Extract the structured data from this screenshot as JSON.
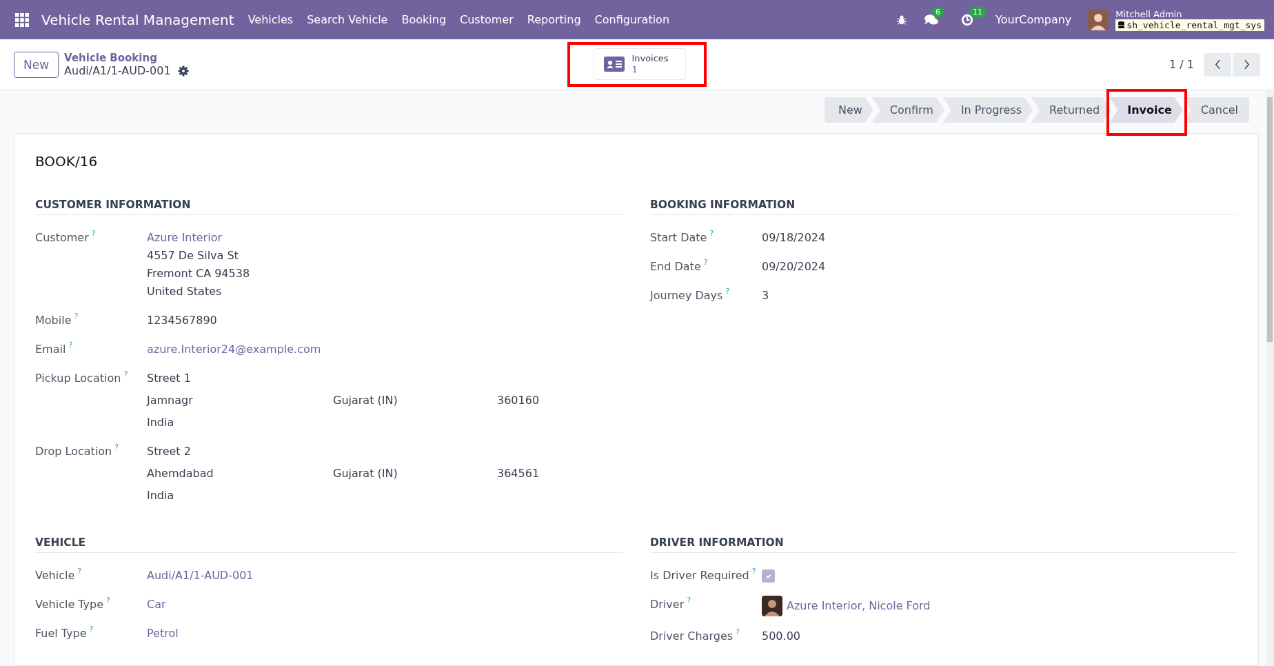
{
  "navbar": {
    "app_title": "Vehicle Rental Management",
    "menu": [
      "Vehicles",
      "Search Vehicle",
      "Booking",
      "Customer",
      "Reporting",
      "Configuration"
    ],
    "messages_count": "6",
    "activities_count": "11",
    "company": "YourCompany",
    "user_name": "Mitchell Admin",
    "database": "sh_vehicle_rental_mgt_sys"
  },
  "control_panel": {
    "new_button": "New",
    "breadcrumb": "Vehicle Booking",
    "record": "Audi/A1/1-AUD-001",
    "smart_button": {
      "label": "Invoices",
      "count": "1",
      "highlighted": true
    },
    "pager": "1 / 1"
  },
  "statusbar": [
    {
      "label": "New",
      "selected": false,
      "highlighted": false
    },
    {
      "label": "Confirm",
      "selected": false,
      "highlighted": false
    },
    {
      "label": "In Progress",
      "selected": false,
      "highlighted": false
    },
    {
      "label": "Returned",
      "selected": false,
      "highlighted": false
    },
    {
      "label": "Invoice",
      "selected": true,
      "highlighted": true
    },
    {
      "label": "Cancel",
      "selected": false,
      "highlighted": false
    }
  ],
  "sheet": {
    "title": "BOOK/16",
    "sections": [
      {
        "title": "CUSTOMER INFORMATION",
        "fields": [
          {
            "kind": "address",
            "label": "Customer",
            "help": "?",
            "link": "Azure Interior",
            "lines": [
              "4557 De Silva St",
              "Fremont CA 94538",
              "United States"
            ]
          },
          {
            "kind": "text",
            "label": "Mobile",
            "help": "?",
            "value": "1234567890"
          },
          {
            "kind": "link",
            "label": "Email",
            "help": "?",
            "value": "azure.Interior24@example.com"
          },
          {
            "kind": "location",
            "label": "Pickup Location",
            "help": "?",
            "street": "Street 1",
            "city": "Jamnagr",
            "state": "Gujarat (IN)",
            "zip": "360160",
            "country": "India"
          },
          {
            "kind": "location",
            "label": "Drop Location",
            "help": "?",
            "street": "Street 2",
            "city": "Ahemdabad",
            "state": "Gujarat (IN)",
            "zip": "364561",
            "country": "India"
          }
        ]
      },
      {
        "title": "BOOKING INFORMATION",
        "fields": [
          {
            "kind": "text",
            "label": "Start Date",
            "help": "?",
            "value": "09/18/2024"
          },
          {
            "kind": "text",
            "label": "End Date",
            "help": "?",
            "value": "09/20/2024"
          },
          {
            "kind": "text",
            "label": "Journey Days",
            "help": "?",
            "value": "3"
          }
        ]
      },
      {
        "title": "VEHICLE",
        "fields": [
          {
            "kind": "link",
            "label": "Vehicle",
            "help": "?",
            "value": "Audi/A1/1-AUD-001"
          },
          {
            "kind": "link",
            "label": "Vehicle Type",
            "help": "?",
            "value": "Car"
          },
          {
            "kind": "link",
            "label": "Fuel Type",
            "help": "?",
            "value": "Petrol"
          }
        ]
      },
      {
        "title": "DRIVER INFORMATION",
        "fields": [
          {
            "kind": "checkbox",
            "label": "Is Driver Required",
            "help": "?",
            "checked": true
          },
          {
            "kind": "avatar_link",
            "label": "Driver",
            "help": "?",
            "value": "Azure Interior, Nicole Ford"
          },
          {
            "kind": "text",
            "label": "Driver Charges",
            "help": "?",
            "value": "500.00"
          }
        ]
      }
    ]
  }
}
